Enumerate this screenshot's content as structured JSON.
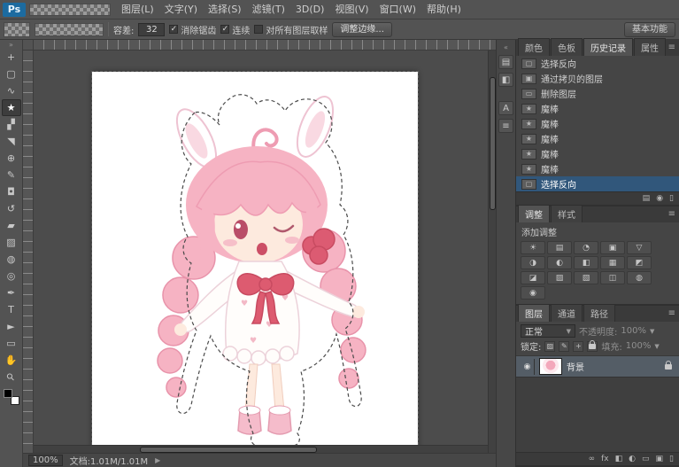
{
  "app": {
    "logo": "Ps",
    "workspace": "基本功能"
  },
  "menu": {
    "items": [
      "图层(L)",
      "文字(Y)",
      "选择(S)",
      "滤镜(T)",
      "3D(D)",
      "视图(V)",
      "窗口(W)",
      "帮助(H)"
    ]
  },
  "options": {
    "tolerance_label": "容差:",
    "tolerance_value": "32",
    "checks": [
      {
        "label": "消除锯齿",
        "mark": "✓"
      },
      {
        "label": "连续",
        "mark": "✓"
      },
      {
        "label": "对所有图层取样",
        "mark": ""
      }
    ],
    "refine_edge": "调整边缘..."
  },
  "tools": [
    {
      "name": "move",
      "glyph": "+"
    },
    {
      "name": "rectangular-marquee",
      "glyph": "▢"
    },
    {
      "name": "lasso",
      "glyph": "∿"
    },
    {
      "name": "magic-wand",
      "glyph": "★"
    },
    {
      "name": "crop",
      "glyph": "▞"
    },
    {
      "name": "eyedropper",
      "glyph": "◥"
    },
    {
      "name": "healing-brush",
      "glyph": "⊕"
    },
    {
      "name": "brush",
      "glyph": "✎"
    },
    {
      "name": "clone-stamp",
      "glyph": "◘"
    },
    {
      "name": "history-brush",
      "glyph": "↺"
    },
    {
      "name": "eraser",
      "glyph": "▰"
    },
    {
      "name": "gradient",
      "glyph": "▨"
    },
    {
      "name": "blur",
      "glyph": "◍"
    },
    {
      "name": "dodge",
      "glyph": "◎"
    },
    {
      "name": "pen",
      "glyph": "✒"
    },
    {
      "name": "type",
      "glyph": "T"
    },
    {
      "name": "path-selection",
      "glyph": "►"
    },
    {
      "name": "rectangle",
      "glyph": "▭"
    },
    {
      "name": "hand",
      "glyph": "✋"
    },
    {
      "name": "zoom",
      "glyph": "⚲"
    }
  ],
  "strip": {
    "icons": [
      "▤",
      "◧",
      "A",
      "≡"
    ]
  },
  "panels": {
    "history": {
      "tabs": [
        "颜色",
        "色板",
        "历史记录",
        "属性"
      ],
      "items": [
        {
          "label": "选择反向",
          "glyph": "▢"
        },
        {
          "label": "通过拷贝的图层",
          "glyph": "▣"
        },
        {
          "label": "删除图层",
          "glyph": "▭"
        },
        {
          "label": "魔棒",
          "glyph": "★"
        },
        {
          "label": "魔棒",
          "glyph": "★"
        },
        {
          "label": "魔棒",
          "glyph": "★"
        },
        {
          "label": "魔棒",
          "glyph": "★"
        },
        {
          "label": "魔棒",
          "glyph": "★"
        },
        {
          "label": "选择反向",
          "glyph": "▢"
        }
      ],
      "footer": [
        "▤",
        "◉",
        "▯"
      ]
    },
    "adjust": {
      "tabs": [
        "调整",
        "样式"
      ],
      "title": "添加调整",
      "grid": [
        "☀",
        "▤",
        "◔",
        "▣",
        "▽",
        "◑",
        "◐",
        "◧",
        "▦",
        "◩",
        "◪",
        "▨",
        "▧",
        "◫",
        "◍",
        "◉"
      ]
    },
    "layers": {
      "tabs": [
        "图层",
        "通道",
        "路径"
      ],
      "blend": "正常",
      "opacity_label": "不透明度:",
      "opacity": "100%",
      "lock_label": "锁定:",
      "lock_icons": [
        "▨",
        "✎",
        "+"
      ],
      "fill_label": "填充:",
      "fill": "100%",
      "layer": {
        "name": "背景",
        "eye": "◉"
      },
      "footer": [
        "∞",
        "fx",
        "◧",
        "◐",
        "▭",
        "▣",
        "▯"
      ]
    }
  },
  "status": {
    "zoom": "100%",
    "doc": "文档:1.01M/1.01M"
  }
}
